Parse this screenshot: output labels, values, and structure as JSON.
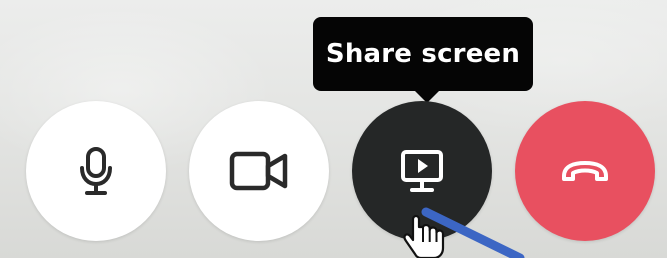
{
  "tooltip": {
    "text": "Share screen"
  },
  "controls": [
    {
      "id": "mic",
      "icon": "microphone-icon",
      "state": "idle"
    },
    {
      "id": "camera",
      "icon": "video-camera-icon",
      "state": "idle"
    },
    {
      "id": "share",
      "icon": "screen-share-icon",
      "state": "hover"
    },
    {
      "id": "end-call",
      "icon": "phone-hangup-icon",
      "state": "danger"
    }
  ],
  "colors": {
    "button_light": "#ffffff",
    "button_hover": "#252727",
    "end_call": "#e85060",
    "tooltip_bg": "#050505",
    "icon_dark": "#2a2a2a",
    "pen_annotation": "#3c66c4"
  },
  "cursor": "hand-pointer-icon"
}
